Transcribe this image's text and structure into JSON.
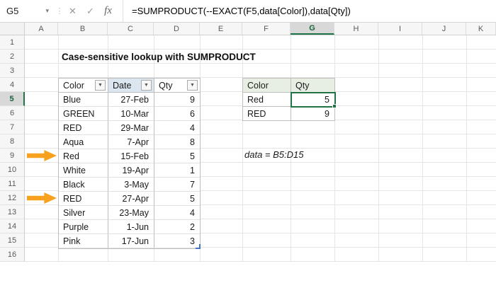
{
  "name_box": "G5",
  "formula_bar": {
    "formula": "=SUMPRODUCT(--EXACT(F5,data[Color]),data[Qty])"
  },
  "ui": {
    "icons": {
      "cancel": "✕",
      "accept": "✓",
      "fx": "fx",
      "chevron": "▾",
      "filter": "▼"
    }
  },
  "columns": [
    "A",
    "B",
    "C",
    "D",
    "E",
    "F",
    "G",
    "H",
    "I",
    "J",
    "K"
  ],
  "rows": [
    "1",
    "2",
    "3",
    "4",
    "5",
    "6",
    "7",
    "8",
    "9",
    "10",
    "11",
    "12",
    "13",
    "14",
    "15",
    "16"
  ],
  "title": "Case-sensitive lookup with SUMPRODUCT",
  "main_table": {
    "headers": [
      "Color",
      "Date",
      "Qty"
    ],
    "rows": [
      [
        "Blue",
        "27-Feb",
        "9"
      ],
      [
        "GREEN",
        "10-Mar",
        "6"
      ],
      [
        "RED",
        "29-Mar",
        "4"
      ],
      [
        "Aqua",
        "7-Apr",
        "8"
      ],
      [
        "Red",
        "15-Feb",
        "5"
      ],
      [
        "White",
        "19-Apr",
        "1"
      ],
      [
        "Black",
        "3-May",
        "7"
      ],
      [
        "RED",
        "27-Apr",
        "5"
      ],
      [
        "Silver",
        "23-May",
        "4"
      ],
      [
        "Purple",
        "1-Jun",
        "2"
      ],
      [
        "Pink",
        "17-Jun",
        "3"
      ]
    ]
  },
  "lookup_table": {
    "headers": [
      "Color",
      "Qty"
    ],
    "rows": [
      [
        "Red",
        "5"
      ],
      [
        "RED",
        "9"
      ]
    ]
  },
  "annotation": "data = B5:D15",
  "selected_cell": {
    "ref": "G5",
    "value": "5"
  },
  "colors": {
    "selection_green": "#217346",
    "arrow_orange": "#F7A11F",
    "lookup_header_fill": "#E7EFE2",
    "date_header_fill": "#DCE6F1",
    "table_handle_blue": "#4472C4"
  }
}
